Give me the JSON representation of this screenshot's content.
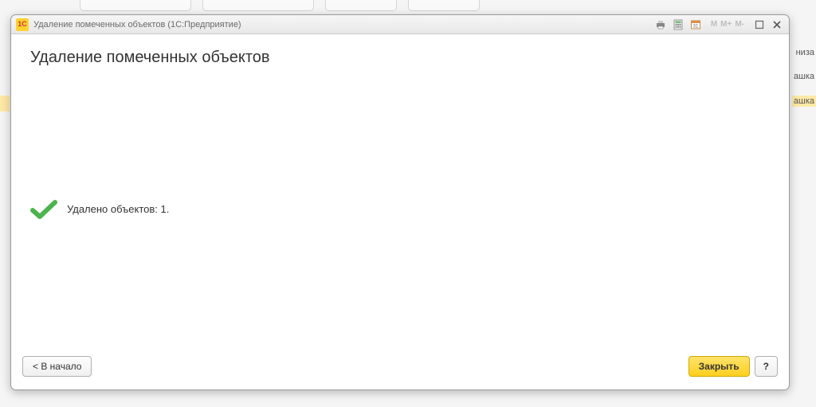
{
  "background": {
    "fragments": [
      "низа",
      "ашка",
      "ашка"
    ]
  },
  "titlebar": {
    "title": "Удаление помеченных объектов (1С:Предприятие)",
    "logo_text": "1С",
    "m_labels": [
      "M",
      "M+",
      "M-"
    ]
  },
  "page": {
    "title": "Удаление помеченных объектов"
  },
  "result": {
    "text": "Удалено объектов: 1."
  },
  "footer": {
    "back_label": "< В начало",
    "close_label": "Закрыть",
    "help_label": "?"
  }
}
